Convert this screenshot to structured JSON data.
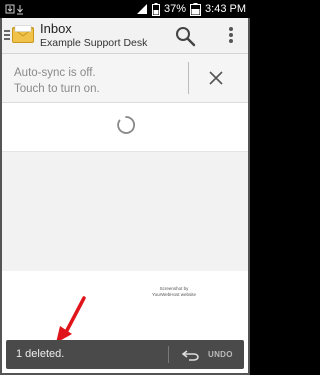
{
  "status_bar": {
    "battery_percent": "37%",
    "time": "3:43 PM"
  },
  "action_bar": {
    "title": "Inbox",
    "subtitle": "Example Support Desk"
  },
  "autosync": {
    "line1": "Auto-sync is off.",
    "line2": "Touch to turn on."
  },
  "attribution": {
    "line1": "Screenshot by",
    "line2": "YourWebHost website"
  },
  "snackbar": {
    "message": "1 deleted.",
    "undo_label": "UNDO"
  },
  "colors": {
    "annotation_arrow": "#e0151b",
    "snackbar_bg": "#4a4a4a"
  }
}
